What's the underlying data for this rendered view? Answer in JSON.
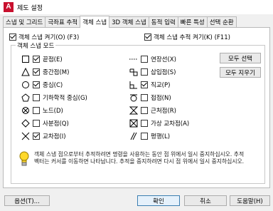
{
  "window": {
    "title": "제도 설정",
    "logo": "A"
  },
  "tabs": [
    {
      "label": "스냅 및 그리드"
    },
    {
      "label": "극좌표 추적"
    },
    {
      "label": "객체 스냅"
    },
    {
      "label": "3D 객체 스냅"
    },
    {
      "label": "동적 입력"
    },
    {
      "label": "빠른 특성"
    },
    {
      "label": "선택 순환"
    }
  ],
  "top_options": {
    "osnap_on": {
      "label": "객체 스냅 켜기(O) (F3)",
      "checked": true
    },
    "osnap_tracking": {
      "label": "객체 스냅 추적 켜기(K) (F11)",
      "checked": true
    }
  },
  "group": {
    "title": "객체 스냅 모드",
    "left_items": [
      {
        "label": "끝점(E)",
        "checked": true,
        "icon": "endpoint-square-icon"
      },
      {
        "label": "중간점(M)",
        "checked": true,
        "icon": "midpoint-triangle-icon"
      },
      {
        "label": "중심(C)",
        "checked": true,
        "icon": "center-circle-icon"
      },
      {
        "label": "기하학적 중심(G)",
        "checked": false,
        "icon": "geometric-center-icon"
      },
      {
        "label": "노드(D)",
        "checked": false,
        "icon": "node-icon"
      },
      {
        "label": "사분점(Q)",
        "checked": false,
        "icon": "quadrant-diamond-icon"
      },
      {
        "label": "교차점(I)",
        "checked": true,
        "icon": "intersection-x-icon"
      }
    ],
    "right_items": [
      {
        "label": "연장선(X)",
        "checked": false,
        "icon": "extension-dots-icon"
      },
      {
        "label": "삽입점(S)",
        "checked": false,
        "icon": "insertion-icon"
      },
      {
        "label": "직교(P)",
        "checked": true,
        "icon": "perpendicular-icon"
      },
      {
        "label": "접점(N)",
        "checked": false,
        "icon": "tangent-icon"
      },
      {
        "label": "근처점(R)",
        "checked": false,
        "icon": "nearest-hourglass-icon"
      },
      {
        "label": "가상 교차점(A)",
        "checked": false,
        "icon": "apparent-intersection-icon"
      },
      {
        "label": "평행(L)",
        "checked": false,
        "icon": "parallel-icon"
      }
    ],
    "select_all": "모두 선택",
    "clear_all": "모두 지우기",
    "info_text": "객체 스냅 점으로부터 추적하려면 명령을 사용하는 동안 점 위에서 일시 중지하십시오. 추적 벡터는 커서를 이동하면 나타납니다. 추적을 중지하려면 다시 점 위에서 일시 중지하십시오."
  },
  "buttons": {
    "options": "옵션(T)...",
    "ok": "확인",
    "cancel": "취소",
    "help": "도움말(H)"
  },
  "colors": {
    "accent": "#3c7fb1",
    "logo_bg": "#c8102e"
  }
}
